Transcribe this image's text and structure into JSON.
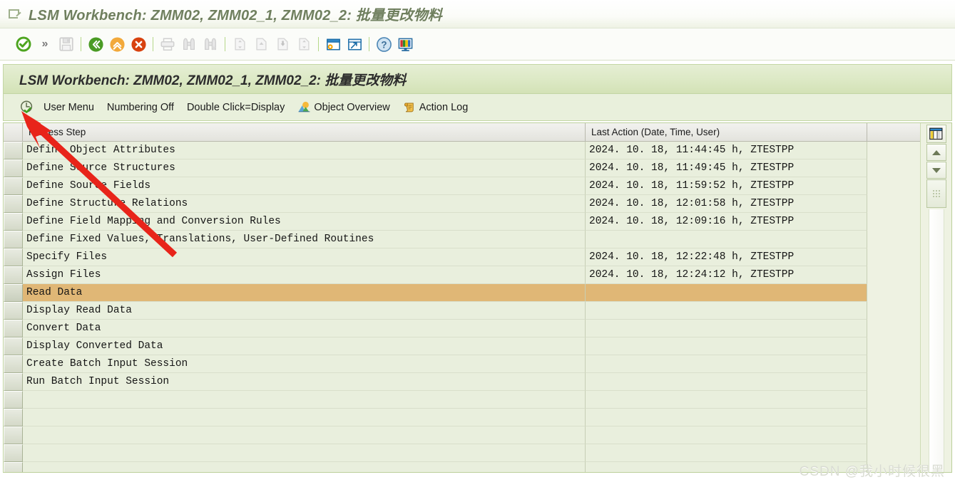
{
  "window": {
    "title": "LSM Workbench: ZMM02, ZMM02_1, ZMM02_2: 批量更改物料",
    "title_icon": "edit-document-icon"
  },
  "toolbar": {
    "buttons": [
      {
        "name": "enter-button",
        "icon": "green-check-circle-icon",
        "enabled": true
      },
      {
        "name": "more-commands-button",
        "icon": "double-chevron-right-icon",
        "enabled": true
      },
      {
        "name": "save-button",
        "icon": "floppy-disk-icon",
        "enabled": false
      },
      {
        "name": "back-button",
        "icon": "green-back-arrow-icon",
        "enabled": true
      },
      {
        "name": "exit-button",
        "icon": "orange-up-arrow-icon",
        "enabled": true
      },
      {
        "name": "cancel-button",
        "icon": "red-x-circle-icon",
        "enabled": true
      },
      {
        "name": "print-button",
        "icon": "printer-icon",
        "enabled": false
      },
      {
        "name": "find-button",
        "icon": "binoculars-icon",
        "enabled": false
      },
      {
        "name": "find-next-button",
        "icon": "binoculars-plus-icon",
        "enabled": false
      },
      {
        "name": "first-page-button",
        "icon": "page-first-icon",
        "enabled": false
      },
      {
        "name": "previous-page-button",
        "icon": "page-up-icon",
        "enabled": false
      },
      {
        "name": "next-page-button",
        "icon": "page-down-icon",
        "enabled": false
      },
      {
        "name": "last-page-button",
        "icon": "page-last-icon",
        "enabled": false
      },
      {
        "name": "create-session-button",
        "icon": "window-gear-icon",
        "enabled": true
      },
      {
        "name": "create-shortcut-button",
        "icon": "window-shortcut-icon",
        "enabled": true
      },
      {
        "name": "help-button",
        "icon": "question-mark-icon",
        "enabled": true
      },
      {
        "name": "customize-layout-button",
        "icon": "monitor-colors-icon",
        "enabled": true
      }
    ]
  },
  "header": {
    "title": "LSM Workbench: ZMM02, ZMM02_1, ZMM02_2: 批量更改物料"
  },
  "menubar": {
    "execute_icon": "clock-check-icon",
    "items": [
      {
        "label": "User Menu",
        "icon": null
      },
      {
        "label": "Numbering Off",
        "icon": null
      },
      {
        "label": "Double Click=Display",
        "icon": null
      },
      {
        "label": "Object Overview",
        "icon": "mountain-sun-icon"
      },
      {
        "label": "Action Log",
        "icon": "scroll-icon"
      }
    ]
  },
  "table": {
    "columns": [
      "Process Step",
      "Last Action (Date, Time, User)"
    ],
    "rows": [
      {
        "step": "Define Object Attributes",
        "last_action": "2024. 10. 18,  11:44:45 h,  ZTESTPP",
        "selected": false
      },
      {
        "step": "Define Source Structures",
        "last_action": "2024. 10. 18,  11:49:45 h,  ZTESTPP",
        "selected": false
      },
      {
        "step": "Define Source Fields",
        "last_action": "2024. 10. 18,  11:59:52 h,  ZTESTPP",
        "selected": false
      },
      {
        "step": "Define Structure Relations",
        "last_action": "2024. 10. 18,  12:01:58 h,  ZTESTPP",
        "selected": false
      },
      {
        "step": "Define Field Mapping and Conversion Rules",
        "last_action": "2024. 10. 18,  12:09:16 h,  ZTESTPP",
        "selected": false
      },
      {
        "step": "Define Fixed Values, Translations, User-Defined Routines",
        "last_action": "",
        "selected": false
      },
      {
        "step": "Specify Files",
        "last_action": "2024. 10. 18,  12:22:48 h,  ZTESTPP",
        "selected": false
      },
      {
        "step": "Assign Files",
        "last_action": "2024. 10. 18,  12:24:12 h,  ZTESTPP",
        "selected": false
      },
      {
        "step": "Read Data",
        "last_action": "",
        "selected": true
      },
      {
        "step": "Display Read Data",
        "last_action": "",
        "selected": false
      },
      {
        "step": "Convert Data",
        "last_action": "",
        "selected": false
      },
      {
        "step": "Display Converted Data",
        "last_action": "",
        "selected": false
      },
      {
        "step": "Create Batch Input Session",
        "last_action": "",
        "selected": false
      },
      {
        "step": "Run Batch Input Session",
        "last_action": "",
        "selected": false
      },
      {
        "step": "",
        "last_action": "",
        "selected": false
      },
      {
        "step": "",
        "last_action": "",
        "selected": false
      },
      {
        "step": "",
        "last_action": "",
        "selected": false
      },
      {
        "step": "",
        "last_action": "",
        "selected": false
      },
      {
        "step": "",
        "last_action": "",
        "selected": false
      }
    ]
  },
  "side_controls": {
    "column_config_icon": "table-columns-icon",
    "scroll_up_icon": "triangle-up-icon",
    "scroll_down_icon": "triangle-down-icon",
    "scroll_thumb_icon": "scrollbar-thumb-grip"
  },
  "annotation": {
    "pointer": "red-arrow-pointing-to-execute-button"
  },
  "watermark": {
    "text": "CSDN @我小时候很黑"
  },
  "colors": {
    "selected_row": "#e0b776",
    "header_green": "#dde9c6",
    "grid_background": "#e9efdd",
    "title_text": "#6f7f5e",
    "annotation_red": "#e8241a"
  }
}
